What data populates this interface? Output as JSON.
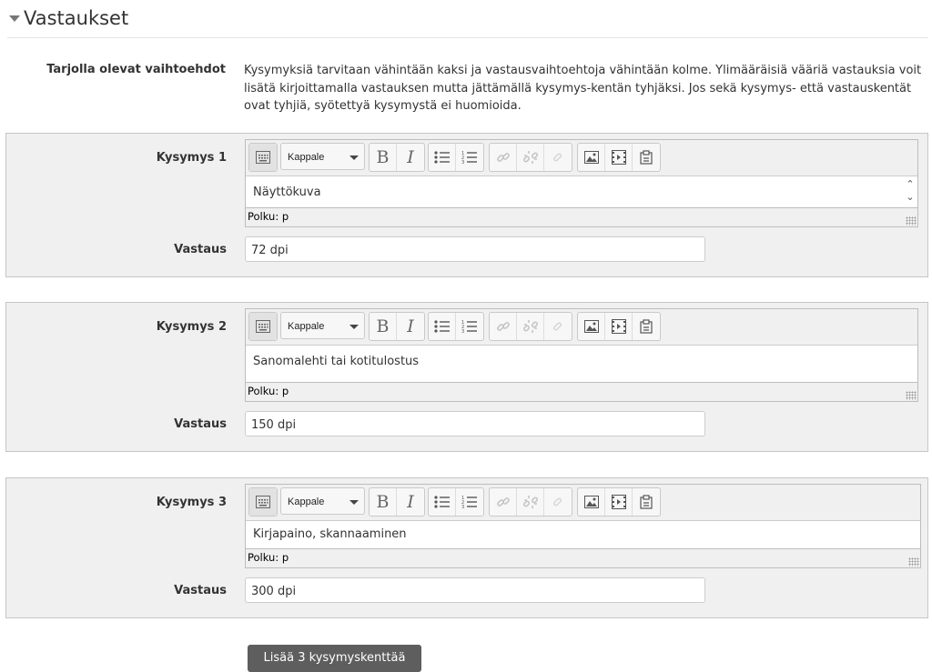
{
  "section": {
    "title": "Vastaukset"
  },
  "intro": {
    "label": "Tarjolla olevat vaihtoehdot",
    "text": "Kysymyksiä tarvitaan vähintään kaksi ja vastausvaihtoehtoja vähintään kolme. Ylimääräisiä vääriä vastauksia voit lisätä kirjoittamalla vastauksen mutta jättämällä kysymys-kentän tyhjäksi. Jos sekä kysymys- että vastauskentät ovat tyhjiä, syötettyä kysymystä ei huomioida."
  },
  "editor": {
    "format": "Kappale",
    "path": "Polku: p"
  },
  "questions": [
    {
      "label": "Kysymys 1",
      "text": "Näyttökuva",
      "answer_label": "Vastaus",
      "answer": "72 dpi"
    },
    {
      "label": "Kysymys 2",
      "text": "Sanomalehti tai kotitulostus",
      "answer_label": "Vastaus",
      "answer": "150 dpi"
    },
    {
      "label": "Kysymys 3",
      "text": "Kirjapaino, skannaaminen",
      "answer_label": "Vastaus",
      "answer": "300 dpi"
    }
  ],
  "add_button": "Lisää 3 kysymyskenttää",
  "icons": [
    "toggle-toolbar-icon",
    "bold-icon",
    "italic-icon",
    "bullet-list-icon",
    "numbered-list-icon",
    "link-icon",
    "unlink-icon",
    "anchor-icon",
    "image-icon",
    "media-icon",
    "paste-icon"
  ]
}
